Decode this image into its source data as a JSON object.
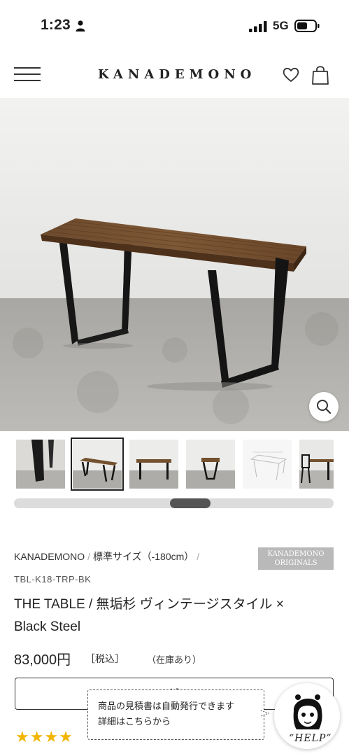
{
  "status_bar": {
    "time": "1:23",
    "network": "5G"
  },
  "header": {
    "logo": "KANADEMONO"
  },
  "breadcrumb": {
    "brand": "KANADEMONO",
    "sep1": "/",
    "category": "標準サイズ（-180cm）",
    "sep2": "/"
  },
  "badge": {
    "line1": "KANADEMONO",
    "line2": "ORIGINALS"
  },
  "product": {
    "sku": "TBL-K18-TRP-BK",
    "title_line1": "THE TABLE / 無垢杉 ヴィンテージスタイル ×",
    "title_line2": "Black Steel",
    "price": "83,000円",
    "tax": "［税込］",
    "stock": "（在庫あり）",
    "rating_stars": "★★★★"
  },
  "cart_button": {
    "label_visible": "ビ"
  },
  "tooltip": {
    "line1": "商品の見積書は自動発行できます",
    "line2": "詳細はこちらから"
  },
  "help": {
    "label": "“HELP”"
  },
  "gallery": {
    "thumb_count": 6,
    "selected_index": 1
  },
  "icons": [
    "person-icon",
    "signal-icon",
    "battery-icon",
    "menu-icon",
    "heart-icon",
    "bag-icon",
    "search-icon",
    "help-avatar-icon"
  ],
  "colors": {
    "star": "#f2b600",
    "badge_bg": "#b9b9b9",
    "scroll_thumb": "#555555"
  }
}
